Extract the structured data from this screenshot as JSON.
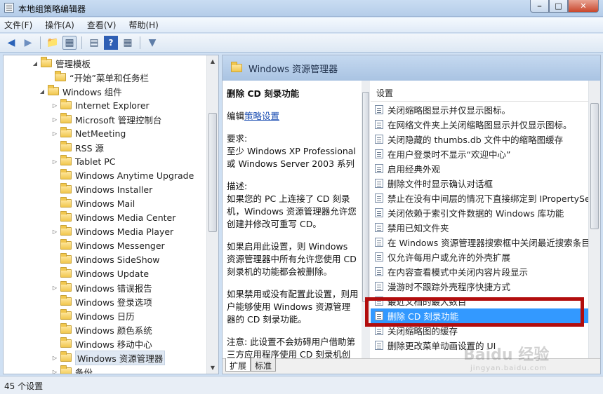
{
  "window": {
    "title": "本地组策略编辑器",
    "controls": [
      "minimize",
      "maximize",
      "close"
    ]
  },
  "menu": [
    {
      "label": "文件(F)"
    },
    {
      "label": "操作(A)"
    },
    {
      "label": "查看(V)"
    },
    {
      "label": "帮助(H)"
    }
  ],
  "toolbar": {
    "icons": [
      "back-arrow-icon",
      "forward-arrow-icon",
      "up-folder-icon",
      "show-hide-tree-icon",
      "properties-icon",
      "help-icon",
      "view-icon",
      "filter-icon"
    ]
  },
  "tree": {
    "items": [
      {
        "label": "管理模板",
        "expanded": true
      },
      {
        "label": "“开始”菜单和任务栏"
      },
      {
        "label": "Windows 组件",
        "expanded": true
      },
      {
        "label": "Internet Explorer"
      },
      {
        "label": "Microsoft 管理控制台"
      },
      {
        "label": "NetMeeting"
      },
      {
        "label": "RSS 源"
      },
      {
        "label": "Tablet PC"
      },
      {
        "label": "Windows Anytime Upgrade"
      },
      {
        "label": "Windows Installer"
      },
      {
        "label": "Windows Mail"
      },
      {
        "label": "Windows Media Center"
      },
      {
        "label": "Windows Media Player"
      },
      {
        "label": "Windows Messenger"
      },
      {
        "label": "Windows SideShow"
      },
      {
        "label": "Windows Update"
      },
      {
        "label": "Windows 错误报告"
      },
      {
        "label": "Windows 登录选项"
      },
      {
        "label": "Windows 日历"
      },
      {
        "label": "Windows 颜色系统"
      },
      {
        "label": "Windows 移动中心"
      },
      {
        "label": "Windows 资源管理器",
        "selected": true
      },
      {
        "label": "备份"
      }
    ]
  },
  "right_pane": {
    "header": "Windows 资源管理器",
    "description": {
      "title": "删除 CD 刻录功能",
      "edit_prefix": "编辑",
      "edit_link": "策略设置",
      "requirements_label": "要求:",
      "requirements_text": "至少 Windows XP Professional 或 Windows Server 2003 系列",
      "desc_label": "描述:",
      "desc_text": "如果您的 PC 上连接了 CD 刻录机，Windows 资源管理器允许您创建并修改可重写 CD。",
      "para_enabled": "如果启用此设置，则 Windows 资源管理器中所有允许您使用 CD 刻录机的功能都会被删除。",
      "para_disabled": "如果禁用或没有配置此设置，则用户能够使用 Windows 资源管理器的 CD 刻录功能。",
      "para_note": "注意: 此设置不会妨碍用户借助第三方应用程序使用 CD 刻录机创建"
    },
    "list_header": "设置",
    "settings": [
      "关闭缩略图显示并仅显示图标。",
      "在网络文件夹上关闭缩略图显示并仅显示图标。",
      "关闭隐藏的 thumbs.db 文件中的缩略图缓存",
      "在用户登录时不显示“欢迎中心”",
      "启用经典外观",
      "删除文件时显示确认对话框",
      "禁止在没有中间层的情况下直接绑定到 IPropertySet",
      "关闭依赖于索引文件数据的 Windows 库功能",
      "禁用已知文件夹",
      "在 Windows 资源管理器搜索框中关闭最近搜索条目的",
      "仅允许每用户或允许的外壳扩展",
      "在内容查看模式中关闭内容片段显示",
      "漫游时不跟踪外壳程序快捷方式",
      "最近文档的最大数目",
      "删除 CD 刻录功能",
      "关闭缩略图的缓存",
      "删除更改菜单动画设置的 UI"
    ],
    "selected_setting": "删除 CD 刻录功能",
    "tabs": [
      {
        "label": "扩展",
        "active": true
      },
      {
        "label": "标准",
        "active": false
      }
    ]
  },
  "status": {
    "text": "45 个设置"
  },
  "watermark": {
    "text": "Baidu 经验",
    "sub": "jingyan.baidu.com"
  },
  "colors": {
    "selection": "#3399ff",
    "highlight_box": "#b20d0d",
    "header_bg": "#b7cfea"
  }
}
